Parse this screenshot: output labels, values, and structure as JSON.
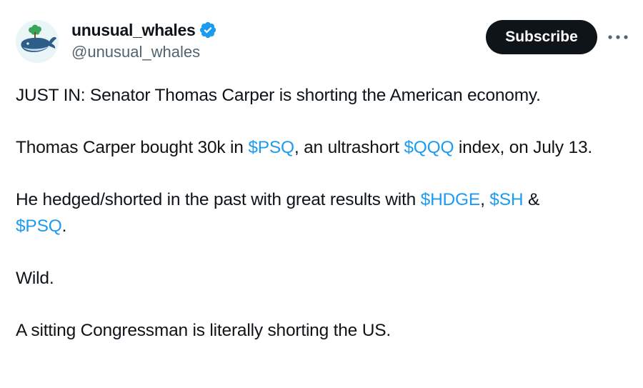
{
  "user": {
    "display_name": "unusual_whales",
    "handle": "@unusual_whales",
    "avatar_icon": "whale-avatar-icon",
    "verified_color": "#1d9bf0"
  },
  "actions": {
    "subscribe_label": "Subscribe",
    "more_icon": "more-horizontal-icon"
  },
  "tweet": {
    "p1": "JUST IN: Senator Thomas Carper is shorting the American economy.",
    "p2": {
      "t1": "Thomas Carper bought 30k in ",
      "l1": "$PSQ",
      "t2": ", an ultrashort ",
      "l2": "$QQQ",
      "t3": " index, on July 13."
    },
    "p3": {
      "t1": "He hedged/shorted in the past with great results with ",
      "l1": "$HDGE",
      "t2": ", ",
      "l2": "$SH",
      "t3": " & ",
      "l3": "$PSQ",
      "t4": "."
    },
    "p4": "Wild.",
    "p5": "A sitting Congressman is literally shorting the US."
  },
  "colors": {
    "link": "#1d9bf0",
    "text": "#0f1419",
    "secondary": "#536471",
    "button_bg": "#0f1419"
  }
}
